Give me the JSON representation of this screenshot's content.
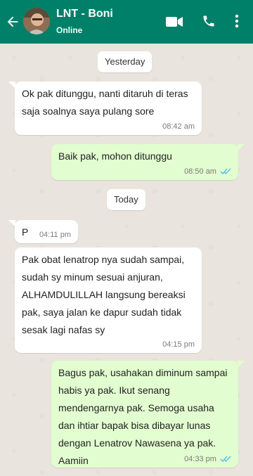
{
  "header": {
    "contact_name": "LNT - Boni",
    "status": "Online"
  },
  "colors": {
    "header_bg": "#008069",
    "incoming_bubble": "#ffffff",
    "outgoing_bubble": "#e2fdd0",
    "read_ticks": "#53bdeb"
  },
  "icons": {
    "back": "back-arrow-icon",
    "video": "video-call-icon",
    "phone": "phone-icon",
    "menu": "more-vertical-icon"
  },
  "dates": {
    "yesterday": "Yesterday",
    "today": "Today"
  },
  "messages": [
    {
      "direction": "incoming",
      "text": "Ok pak ditunggu, nanti ditaruh di teras saja soalnya saya pulang sore",
      "time": "08:42 am"
    },
    {
      "direction": "outgoing",
      "text": "Baik pak, mohon ditunggu",
      "time": "08:50 am",
      "status": "read"
    },
    {
      "direction": "incoming",
      "text": "P",
      "time": "04:11 pm"
    },
    {
      "direction": "incoming",
      "text": "Pak obat lenatrop nya sudah sampai, sudah sy minum sesuai anjuran, ALHAMDULILLAH langsung bereaksi pak, saya jalan ke dapur sudah tidak sesak lagi nafas sy",
      "time": "04:15 pm"
    },
    {
      "direction": "outgoing",
      "text": "Bagus pak, usahakan diminum sampai habis ya pak. Ikut senang mendengarnya pak. Semoga usaha dan ihtiar bapak bisa dibayar lunas dengan Lenatrov Nawasena ya pak. Aamiin",
      "time": "04:33 pm",
      "status": "read"
    }
  ]
}
